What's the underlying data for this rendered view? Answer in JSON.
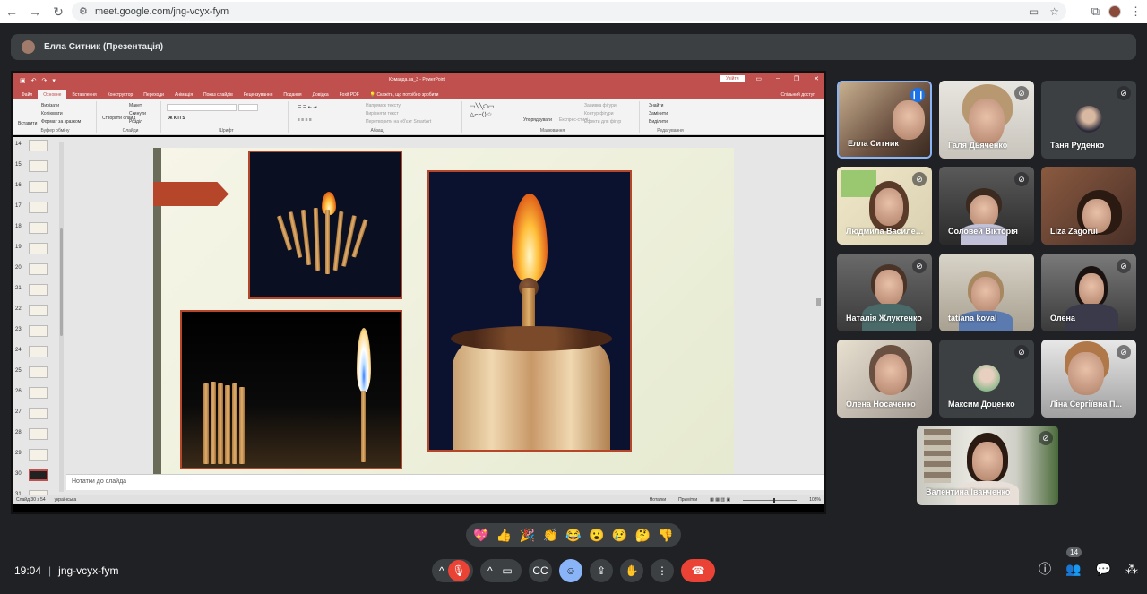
{
  "browser": {
    "url": "meet.google.com/jng-vcyx-fym"
  },
  "presenter": {
    "label": "Елла Ситник (Презентація)"
  },
  "powerpoint": {
    "document_title": "Команда.ua_3  -  PowerPoint",
    "sign_in": "Увійти",
    "tabs": [
      "Файл",
      "Основне",
      "Вставлення",
      "Конструктор",
      "Переходи",
      "Анімація",
      "Показ слайдів",
      "Рецензування",
      "Подання",
      "Довідка",
      "Foxit PDF"
    ],
    "search_hint": "Скажіть, що потрібно зробити",
    "share": "Спільний доступ",
    "ribbon": {
      "paste": "Вставити",
      "cut": "Вирізати",
      "copy": "Копіювати",
      "format_painter": "Формат за зразком",
      "clipboard": "Буфер обміну",
      "new_slide": "Створити слайд",
      "layout": "Макет",
      "reset": "Скинути",
      "section": "Розділ",
      "slides": "Слайди",
      "font": "Шрифт",
      "text_direction": "Напрямок тексту",
      "align_text": "Вирівняти текст",
      "smartart": "Перетворити на об'єкт SmartArt",
      "paragraph": "Абзац",
      "arrange": "Упорядкувати",
      "quick_styles": "Експрес-стилі",
      "shape_fill": "Заливка фігури",
      "shape_outline": "Контур фігури",
      "shape_effects": "Ефекти для фігур",
      "drawing": "Малювання",
      "find": "Знайти",
      "replace": "Замінити",
      "select": "Виділити",
      "editing": "Редагування"
    },
    "thumbnails": [
      "14",
      "15",
      "16",
      "17",
      "18",
      "19",
      "20",
      "21",
      "22",
      "23",
      "24",
      "25",
      "26",
      "27",
      "28",
      "29",
      "30",
      "31"
    ],
    "active_slide": "30",
    "notes_placeholder": "Нотатки до слайда",
    "status": {
      "slide_info": "Слайд 30 з 54",
      "language": "українська",
      "notes": "Нотатки",
      "comments": "Примітки",
      "zoom": "108%"
    }
  },
  "participants": [
    {
      "name": "Елла Ситник",
      "speaking": true,
      "muted": false
    },
    {
      "name": "Галя Дьяченко",
      "speaking": false,
      "muted": true
    },
    {
      "name": "Таня Руденко",
      "speaking": false,
      "muted": true
    },
    {
      "name": "Людмила Василенко",
      "speaking": false,
      "muted": true
    },
    {
      "name": "Соловей Вікторія",
      "speaking": false,
      "muted": true
    },
    {
      "name": "Liza Zagorui",
      "speaking": false,
      "muted": false
    },
    {
      "name": "Наталія Жлуктенко",
      "speaking": false,
      "muted": true
    },
    {
      "name": "tatiana koval",
      "speaking": false,
      "muted": false
    },
    {
      "name": "Олена",
      "speaking": false,
      "muted": true
    },
    {
      "name": "Олена Носаченко",
      "speaking": false,
      "muted": false
    },
    {
      "name": "Максим Доценко",
      "speaking": false,
      "muted": true
    },
    {
      "name": "Ліна Сергіївна П...",
      "speaking": false,
      "muted": true
    },
    {
      "name": "Валентина Іванченко",
      "speaking": false,
      "muted": true
    }
  ],
  "reactions": [
    "💖",
    "👍",
    "🎉",
    "👏",
    "😂",
    "😮",
    "😢",
    "🤔",
    "👎"
  ],
  "meeting": {
    "time": "19:04",
    "separator": "|",
    "code": "jng-vcyx-fym",
    "people_count": "14"
  },
  "colors": {
    "accent_blue": "#8ab4f8",
    "danger_red": "#ea4335",
    "powerpoint_orange": "#c0504d"
  }
}
